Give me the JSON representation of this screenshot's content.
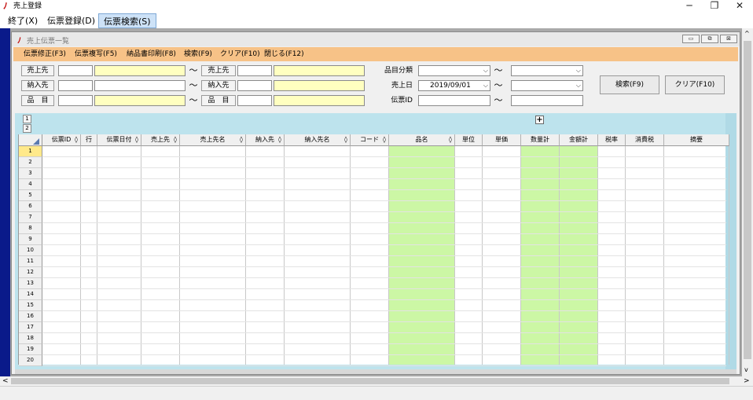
{
  "app": {
    "title": "売上登録"
  },
  "window_controls": {
    "minimize": "─",
    "restore": "❐",
    "close": "✕"
  },
  "menu": [
    {
      "label": "終了(X)"
    },
    {
      "label": "伝票登録(D)"
    },
    {
      "label": "伝票検索(S)"
    }
  ],
  "child_window": {
    "title": "売上伝票一覧",
    "controls": {
      "minimize": "▭",
      "restore": "⧉",
      "close": "⊠"
    }
  },
  "toolbar": [
    {
      "label": "伝票修正(F3)"
    },
    {
      "label": "伝票複写(F5)"
    },
    {
      "label": "納品書印刷(F8)"
    },
    {
      "label": "検索(F9)"
    },
    {
      "label": "クリア(F10)"
    },
    {
      "label": "閉じる(F12)"
    }
  ],
  "search_form": {
    "row1": {
      "label": "売上先",
      "label2": "売上先",
      "code_from": "",
      "name_from": "",
      "code_to": "",
      "name_to": "",
      "tilde": "～"
    },
    "row2": {
      "label": "納入先",
      "label2": "納入先",
      "code_from": "",
      "name_from": "",
      "code_to": "",
      "name_to": "",
      "tilde": "～"
    },
    "row3": {
      "label": "品　目",
      "label2": "品　目",
      "code_from": "",
      "name_from": "",
      "code_to": "",
      "name_to": "",
      "tilde": "～"
    },
    "category": {
      "label": "品目分類",
      "from": "",
      "to": "",
      "tilde": "～"
    },
    "sales_date": {
      "label": "売上日",
      "from": "2019/09/01",
      "to": "",
      "tilde": "～"
    },
    "slip_id": {
      "label": "伝票ID",
      "from": "",
      "to": "",
      "tilde": "～"
    }
  },
  "buttons": {
    "search": "検索(F9)",
    "clear": "クリア(F10)"
  },
  "tabs": [
    "1",
    "2"
  ],
  "plus": "+",
  "sort_glyph": "◊",
  "grid": {
    "columns": [
      {
        "label": "伝票ID",
        "sortable": true
      },
      {
        "label": "行",
        "sortable": false
      },
      {
        "label": "伝票日付",
        "sortable": true
      },
      {
        "label": "売上先",
        "sortable": true
      },
      {
        "label": "売上先名",
        "sortable": true
      },
      {
        "label": "納入先",
        "sortable": true
      },
      {
        "label": "納入先名",
        "sortable": true
      },
      {
        "label": "コード",
        "sortable": true
      },
      {
        "label": "品名",
        "sortable": true
      },
      {
        "label": "単位",
        "sortable": false
      },
      {
        "label": "単価",
        "sortable": false
      },
      {
        "label": "数量計",
        "sortable": false
      },
      {
        "label": "金額計",
        "sortable": false
      },
      {
        "label": "税率",
        "sortable": false
      },
      {
        "label": "消費税",
        "sortable": false
      },
      {
        "label": "摘要",
        "sortable": false
      }
    ],
    "row_numbers": [
      "1",
      "2",
      "3",
      "4",
      "5",
      "6",
      "7",
      "8",
      "9",
      "10",
      "11",
      "12",
      "13",
      "14",
      "15",
      "16",
      "17",
      "18",
      "19",
      "20"
    ],
    "selected_row": "1",
    "highlight_color": "#ccf7a5"
  },
  "scroll_arrows": {
    "left": "<",
    "right": ">",
    "up": "^",
    "down": "v"
  }
}
